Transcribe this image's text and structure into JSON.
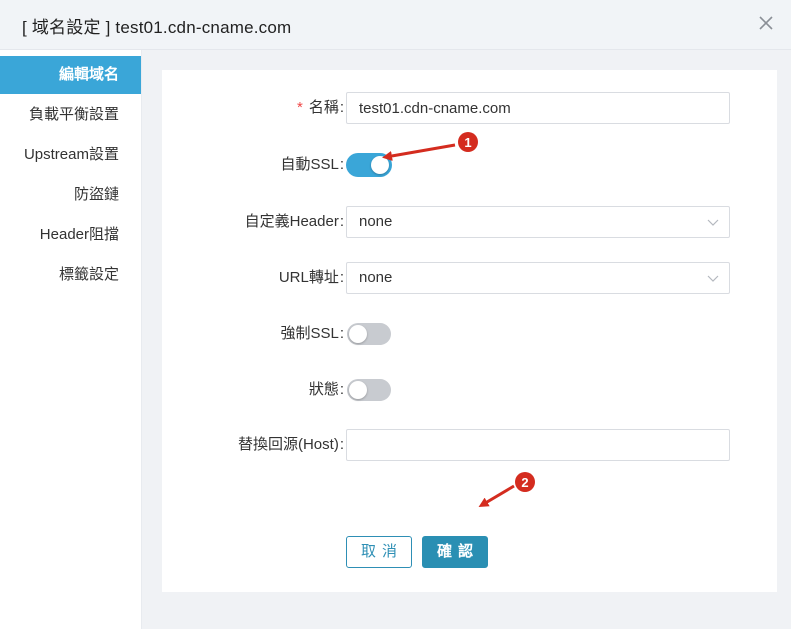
{
  "dialog": {
    "title": "[ 域名設定 ] test01.cdn-cname.com",
    "close_glyph": "X"
  },
  "sidebar": {
    "items": [
      {
        "label": "編輯域名",
        "active": true
      },
      {
        "label": "負載平衡設置",
        "active": false
      },
      {
        "label": "Upstream設置",
        "active": false
      },
      {
        "label": "防盜鏈",
        "active": false
      },
      {
        "label": "Header阻擋",
        "active": false
      },
      {
        "label": "標籤設定",
        "active": false
      }
    ]
  },
  "form": {
    "name": {
      "required_mark": "*",
      "label": "名稱",
      "value": "test01.cdn-cname.com"
    },
    "auto_ssl": {
      "label": "自動SSL",
      "enabled": true
    },
    "custom_header": {
      "label": "自定義Header",
      "selected": "none"
    },
    "url_redirect": {
      "label": "URL轉址",
      "selected": "none"
    },
    "force_ssl": {
      "label": "強制SSL",
      "enabled": false
    },
    "status": {
      "label": "狀態",
      "enabled": false
    },
    "origin_host": {
      "label": "替換回源(Host)",
      "value": ""
    },
    "colon": ":"
  },
  "buttons": {
    "cancel_label": "取消",
    "confirm_label": "確認"
  },
  "annotations": [
    {
      "number": "1",
      "color": "#d42c1f"
    },
    {
      "number": "2",
      "color": "#d42c1f"
    }
  ],
  "colors": {
    "accent": "#3aa6d8",
    "primary_button": "#2a8fb3",
    "required": "#f04646",
    "annotation": "#d42c1f"
  }
}
